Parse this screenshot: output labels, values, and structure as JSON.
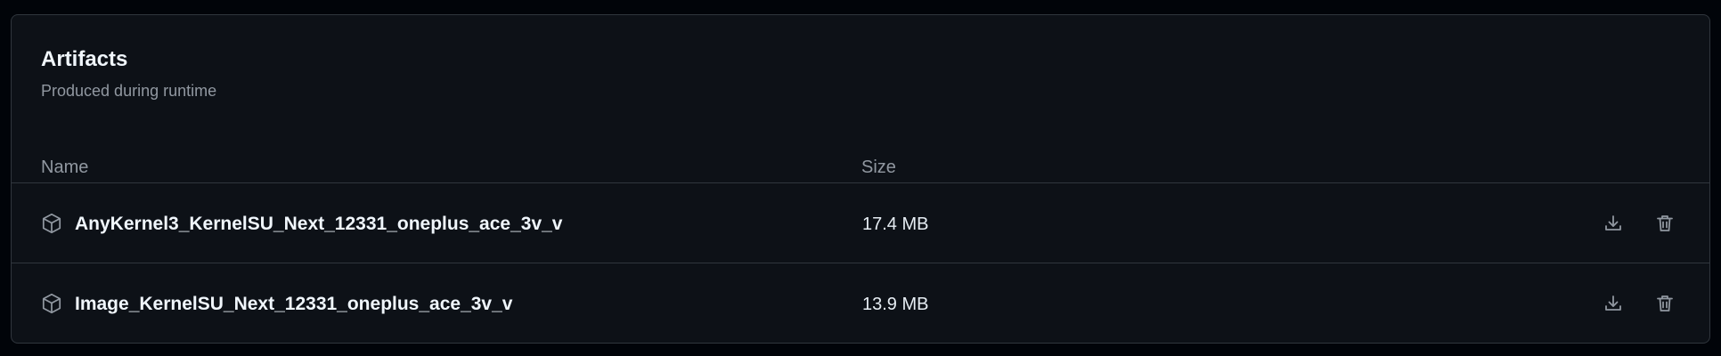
{
  "artifacts": {
    "title": "Artifacts",
    "subtitle": "Produced during runtime",
    "columns": {
      "name": "Name",
      "size": "Size"
    },
    "items": [
      {
        "icon": "package-icon",
        "name": "AnyKernel3_KernelSU_Next_12331_oneplus_ace_3v_v",
        "size": "17.4 MB",
        "actions": [
          "download-icon",
          "trash-icon"
        ]
      },
      {
        "icon": "package-icon",
        "name": "Image_KernelSU_Next_12331_oneplus_ace_3v_v",
        "size": "13.9 MB",
        "actions": [
          "download-icon",
          "trash-icon"
        ]
      }
    ]
  },
  "colors": {
    "background": "#010409",
    "panel": "#0d1117",
    "border": "#30363d",
    "text": "#f0f6fc",
    "muted": "#9198a1"
  }
}
